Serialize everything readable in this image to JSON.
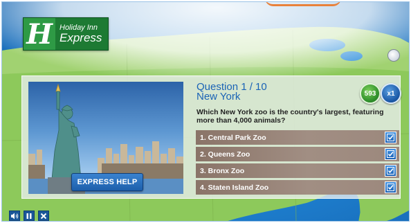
{
  "brand": {
    "logo_line1": "Holiday Inn",
    "logo_line2": "Express",
    "logo_mark": "H",
    "color": "#1d7a33"
  },
  "question": {
    "title": "Question 1 / 10",
    "location": "New York",
    "text": "Which New York zoo is the country's largest, featuring more than 4,000 animals?"
  },
  "badges": {
    "score": "593",
    "multiplier": "x1"
  },
  "help_button": {
    "label": "EXPRESS HELP"
  },
  "answers": [
    {
      "label": "1. Central Park Zoo",
      "icon": "checkbox-icon"
    },
    {
      "label": "2. Queens Zoo",
      "icon": "checkbox-icon"
    },
    {
      "label": "3. Bronx Zoo",
      "icon": "checkbox-icon"
    },
    {
      "label": "4. Staten Island Zoo",
      "icon": "checkbox-icon"
    }
  ],
  "controls": [
    {
      "icon": "speaker-icon"
    },
    {
      "icon": "pause-icon"
    },
    {
      "icon": "close-icon"
    }
  ],
  "colors": {
    "accent_blue": "#1a63b6",
    "answer_bg": "#9c887d",
    "map_land": "#8fca5a",
    "ocean": "#1e7fcf"
  }
}
